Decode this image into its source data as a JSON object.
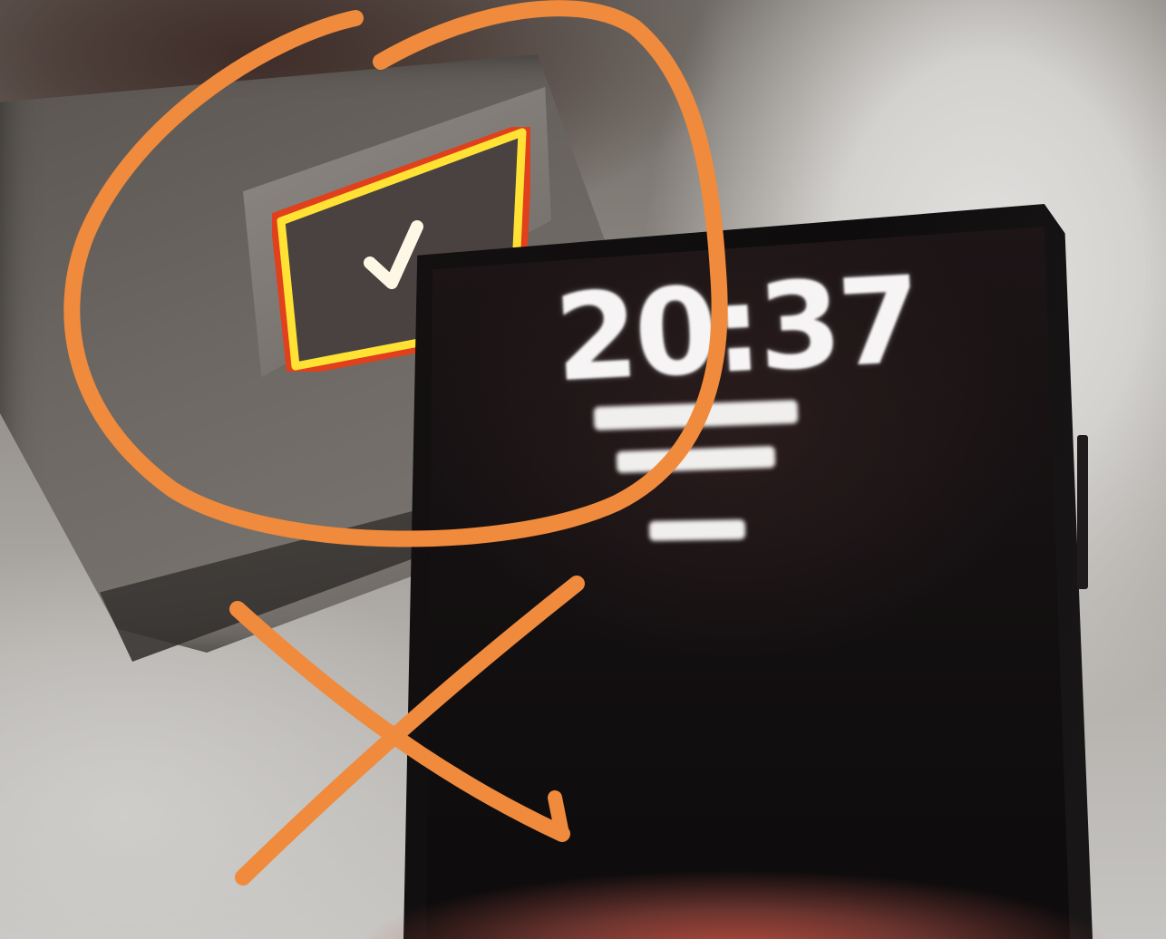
{
  "lock_screen": {
    "time": "20:37"
  },
  "colors": {
    "annotation_orange": "#f08a3c",
    "button_glow": "#ffe233",
    "button_glow_edge": "#e0401c"
  }
}
